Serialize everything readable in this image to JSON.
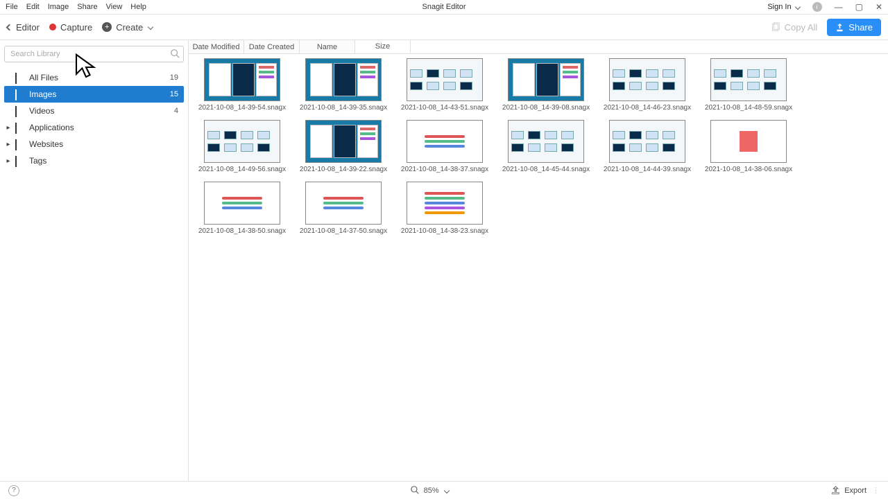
{
  "menubar": {
    "items": [
      "File",
      "Edit",
      "Image",
      "Share",
      "View",
      "Help"
    ],
    "title": "Snagit Editor",
    "signin": "Sign In"
  },
  "toolbar": {
    "editor": "Editor",
    "capture": "Capture",
    "create": "Create",
    "copy_all": "Copy All",
    "share": "Share"
  },
  "sidebar": {
    "search_placeholder": "Search Library",
    "items": [
      {
        "label": "All Files",
        "count": "19",
        "expandable": false
      },
      {
        "label": "Images",
        "count": "15",
        "expandable": false,
        "active": true
      },
      {
        "label": "Videos",
        "count": "4",
        "expandable": false
      },
      {
        "label": "Applications",
        "expandable": true
      },
      {
        "label": "Websites",
        "expandable": true
      },
      {
        "label": "Tags",
        "expandable": true
      }
    ]
  },
  "sort_tabs": [
    "Date Modified",
    "Date Created",
    "Name",
    "Size"
  ],
  "sort_active": 3,
  "files": [
    "2021-10-08_14-39-54.snagx",
    "2021-10-08_14-39-35.snagx",
    "2021-10-08_14-43-51.snagx",
    "2021-10-08_14-39-08.snagx",
    "2021-10-08_14-46-23.snagx",
    "2021-10-08_14-48-59.snagx",
    "2021-10-08_14-49-56.snagx",
    "2021-10-08_14-39-22.snagx",
    "2021-10-08_14-38-37.snagx",
    "2021-10-08_14-45-44.snagx",
    "2021-10-08_14-44-39.snagx",
    "2021-10-08_14-38-06.snagx",
    "2021-10-08_14-38-50.snagx",
    "2021-10-08_14-37-50.snagx",
    "2021-10-08_14-38-23.snagx"
  ],
  "status": {
    "zoom": "85%",
    "export": "Export"
  }
}
